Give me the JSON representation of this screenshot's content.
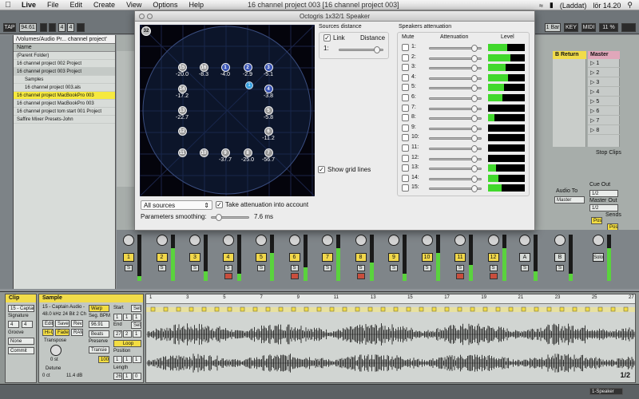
{
  "menubar": {
    "apple": "",
    "app": "Live",
    "items": [
      "File",
      "Edit",
      "Create",
      "View",
      "Options",
      "Help"
    ],
    "document_title": "16 channel project 003  [16 channel project 003]",
    "battery": "(Laddat)",
    "clock": "lör 14.20"
  },
  "transport": {
    "tap": "TAP",
    "tempo": "94.61",
    "meter_num": "4",
    "meter_den": "4",
    "loop_len": "1 Bar",
    "key": "KEY",
    "midi": "MIDI",
    "cpu": "11 %"
  },
  "browser": {
    "path": "/Volumes/Audio Pr... channel project'",
    "column_name": "Name",
    "rows": [
      {
        "label": "(Parent Folder)",
        "state": "normal"
      },
      {
        "label": "16 channel project 002 Project",
        "state": "normal"
      },
      {
        "label": "16 channel project 003 Project",
        "state": "normal"
      },
      {
        "label": "Samples",
        "state": "normal"
      },
      {
        "label": "16 channel project 003.als",
        "state": "normal"
      },
      {
        "label": "16 channel project MacBookPro 003",
        "state": "selected"
      },
      {
        "label": "16 channel project MacBookPro 003",
        "state": "normal"
      },
      {
        "label": "16 channel project tom start 001 Project",
        "state": "normal"
      },
      {
        "label": "Saffire Mixer Presets-John",
        "state": "normal"
      }
    ]
  },
  "session": {
    "return_b": "B Return",
    "master": "Master",
    "scene_numbers": [
      "1",
      "2",
      "3",
      "4",
      "5",
      "6",
      "7",
      "8"
    ],
    "stop_clips": "Stop Clips",
    "audio_to": "Audio To",
    "audio_to_value": "Master",
    "cue_out": "Cue Out",
    "cue_out_value": "1/2",
    "master_out": "Master Out",
    "master_out_value": "1/2",
    "sends": "Sends",
    "post": "Post",
    "track_numbers": [
      "1",
      "2",
      "3",
      "4",
      "5",
      "6",
      "7",
      "8",
      "9",
      "10",
      "11",
      "12"
    ],
    "returns": [
      "A",
      "B"
    ],
    "solo": "Solo",
    "s_label": "S"
  },
  "clip": {
    "clip_header": "Clip",
    "clip_name": "15 - Captain",
    "signature_label": "Signature",
    "sig_num": "4",
    "sig_den": "4",
    "groove_label": "Groove",
    "groove_value": "None",
    "commit": "Commit",
    "sample_header": "Sample",
    "sample_name": "15 - Captain Audio -",
    "sample_info": "48.0 kHz 24 Bit 2 Ch",
    "edit": "Edit",
    "save": "Save",
    "rev": "Rev.",
    "hiq": "Hi-Q",
    "fade": "Fade",
    "ram": "RAM",
    "transpose_label": "Transpose",
    "transpose_value": "0 st",
    "detune_label": "Detune",
    "detune_value": "0 ct",
    "gain_value": "11.4 dB",
    "warp": "Warp",
    "seg_bpm_label": "Seg. BPM",
    "seg_bpm": "96.91",
    "beats": "Beats",
    "preserve": "Preserve",
    "transients": "Transie",
    "mode_value": "100",
    "start_label": "Start",
    "start_values": [
      "1",
      "1",
      "1"
    ],
    "end_label": "End",
    "end_values": [
      "27",
      "2",
      "1"
    ],
    "loop": "Loop",
    "position_label": "Position",
    "position_values": [
      "1",
      "1",
      "1"
    ],
    "length_label": "Length",
    "length_values": [
      "26",
      "1",
      "0"
    ],
    "set": "Set",
    "ruler": [
      "1",
      "3",
      "5",
      "7",
      "9",
      "11",
      "13",
      "15",
      "17",
      "19",
      "21",
      "23",
      "25",
      "27"
    ],
    "page": "1/2"
  },
  "status": {
    "speaker": "1-Speaker"
  },
  "plugin": {
    "title": "Octogris 1x32/1 Speaker",
    "selected_source_badge": "32",
    "speakers": [
      {
        "n": "15",
        "val": "-20.0",
        "type": "grey"
      },
      {
        "n": "16",
        "val": "-8.3",
        "type": "grey"
      },
      {
        "n": "1",
        "val": "-4.0",
        "type": "blue"
      },
      {
        "n": "2",
        "val": "-2.9",
        "type": "blue"
      },
      {
        "n": "3",
        "val": "-5.1",
        "type": "blue"
      },
      {
        "n": "14",
        "val": "-17.2",
        "type": "grey"
      },
      {
        "n": "4",
        "val": "-3.8",
        "type": "blue"
      },
      {
        "n": "13",
        "val": "-22.7",
        "type": "grey"
      },
      {
        "n": "5",
        "val": "-5.8",
        "type": "grey"
      },
      {
        "n": "12",
        "val": "",
        "type": "grey"
      },
      {
        "n": "6",
        "val": "-11.2",
        "type": "grey"
      },
      {
        "n": "11",
        "val": "",
        "type": "grey"
      },
      {
        "n": "10",
        "val": "",
        "type": "grey"
      },
      {
        "n": "9",
        "val": "-37.7",
        "type": "grey"
      },
      {
        "n": "8",
        "val": "-25.0",
        "type": "grey"
      },
      {
        "n": "7",
        "val": "-56.7",
        "type": "grey"
      }
    ],
    "source_label": "1",
    "sources_distance_title": "Sources distance",
    "link_label": "Link",
    "distance_label": "Distance",
    "distance_row": "1:",
    "distance_level": 0.85,
    "show_grid_lines": "Show grid lines",
    "sources_dropdown": "All sources",
    "take_attenuation": "Take attenuation into account",
    "smoothing_label": "Parameters smoothing:",
    "smoothing_value": "7.6 ms",
    "smoothing_level": 0.12,
    "speakers_attenuation_title": "Speakers attenuation",
    "mute_header": "Mute",
    "attenuation_header": "Attenuation",
    "level_header": "Level",
    "rows": [
      {
        "n": "1:",
        "level": 0.52
      },
      {
        "n": "2:",
        "level": 0.6
      },
      {
        "n": "3:",
        "level": 0.48
      },
      {
        "n": "4:",
        "level": 0.55
      },
      {
        "n": "5:",
        "level": 0.44
      },
      {
        "n": "6:",
        "level": 0.4
      },
      {
        "n": "7:",
        "level": 0.0
      },
      {
        "n": "8:",
        "level": 0.18
      },
      {
        "n": "9:",
        "level": 0.0
      },
      {
        "n": "10:",
        "level": 0.0
      },
      {
        "n": "11:",
        "level": 0.0
      },
      {
        "n": "12:",
        "level": 0.0
      },
      {
        "n": "13:",
        "level": 0.22
      },
      {
        "n": "14:",
        "level": 0.28
      },
      {
        "n": "15:",
        "level": 0.36
      }
    ],
    "attenuation_level": 0.84
  },
  "colors": {
    "accent_yellow": "#f3dd42",
    "meter_green": "#41d82c",
    "speaker_blue": "#3b56b6",
    "source_cyan": "#35a0e0"
  }
}
